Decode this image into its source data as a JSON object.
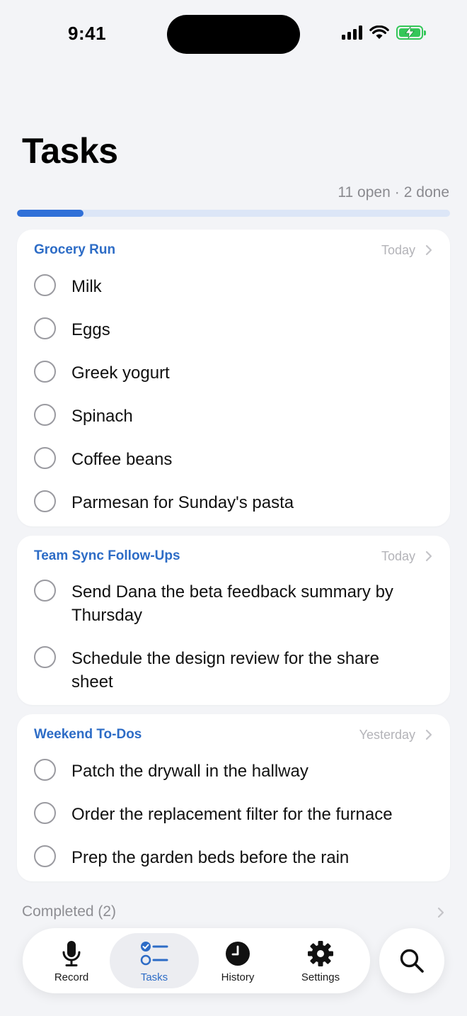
{
  "status_bar": {
    "time": "9:41"
  },
  "header": {
    "title": "Tasks",
    "open_count": "11 open",
    "separator": "·",
    "done_count": "2 done",
    "progress_fraction": 0.154
  },
  "groups": [
    {
      "title": "Grocery Run",
      "date": "Today",
      "tasks": [
        "Milk",
        "Eggs",
        "Greek yogurt",
        "Spinach",
        "Coffee beans",
        "Parmesan for Sunday's pasta"
      ]
    },
    {
      "title": "Team Sync Follow-Ups",
      "date": "Today",
      "tasks": [
        "Send Dana the beta feedback summary by Thursday",
        "Schedule the design review for the share sheet"
      ]
    },
    {
      "title": "Weekend To-Dos",
      "date": "Yesterday",
      "tasks": [
        "Patch the drywall in the hallway",
        "Order the replacement filter for the furnace",
        "Prep the garden beds before the rain"
      ]
    }
  ],
  "completed": {
    "label": "Completed (2)"
  },
  "tab_bar": {
    "tabs": [
      {
        "label": "Record",
        "icon": "microphone-icon"
      },
      {
        "label": "Tasks",
        "icon": "checklist-icon",
        "active": true
      },
      {
        "label": "History",
        "icon": "clock-icon"
      },
      {
        "label": "Settings",
        "icon": "gear-icon"
      }
    ],
    "search_icon": "search-icon"
  },
  "colors": {
    "accent": "#2D6CC6",
    "progress": "#3070D8",
    "background": "#F3F4F7",
    "battery": "#34C759"
  }
}
